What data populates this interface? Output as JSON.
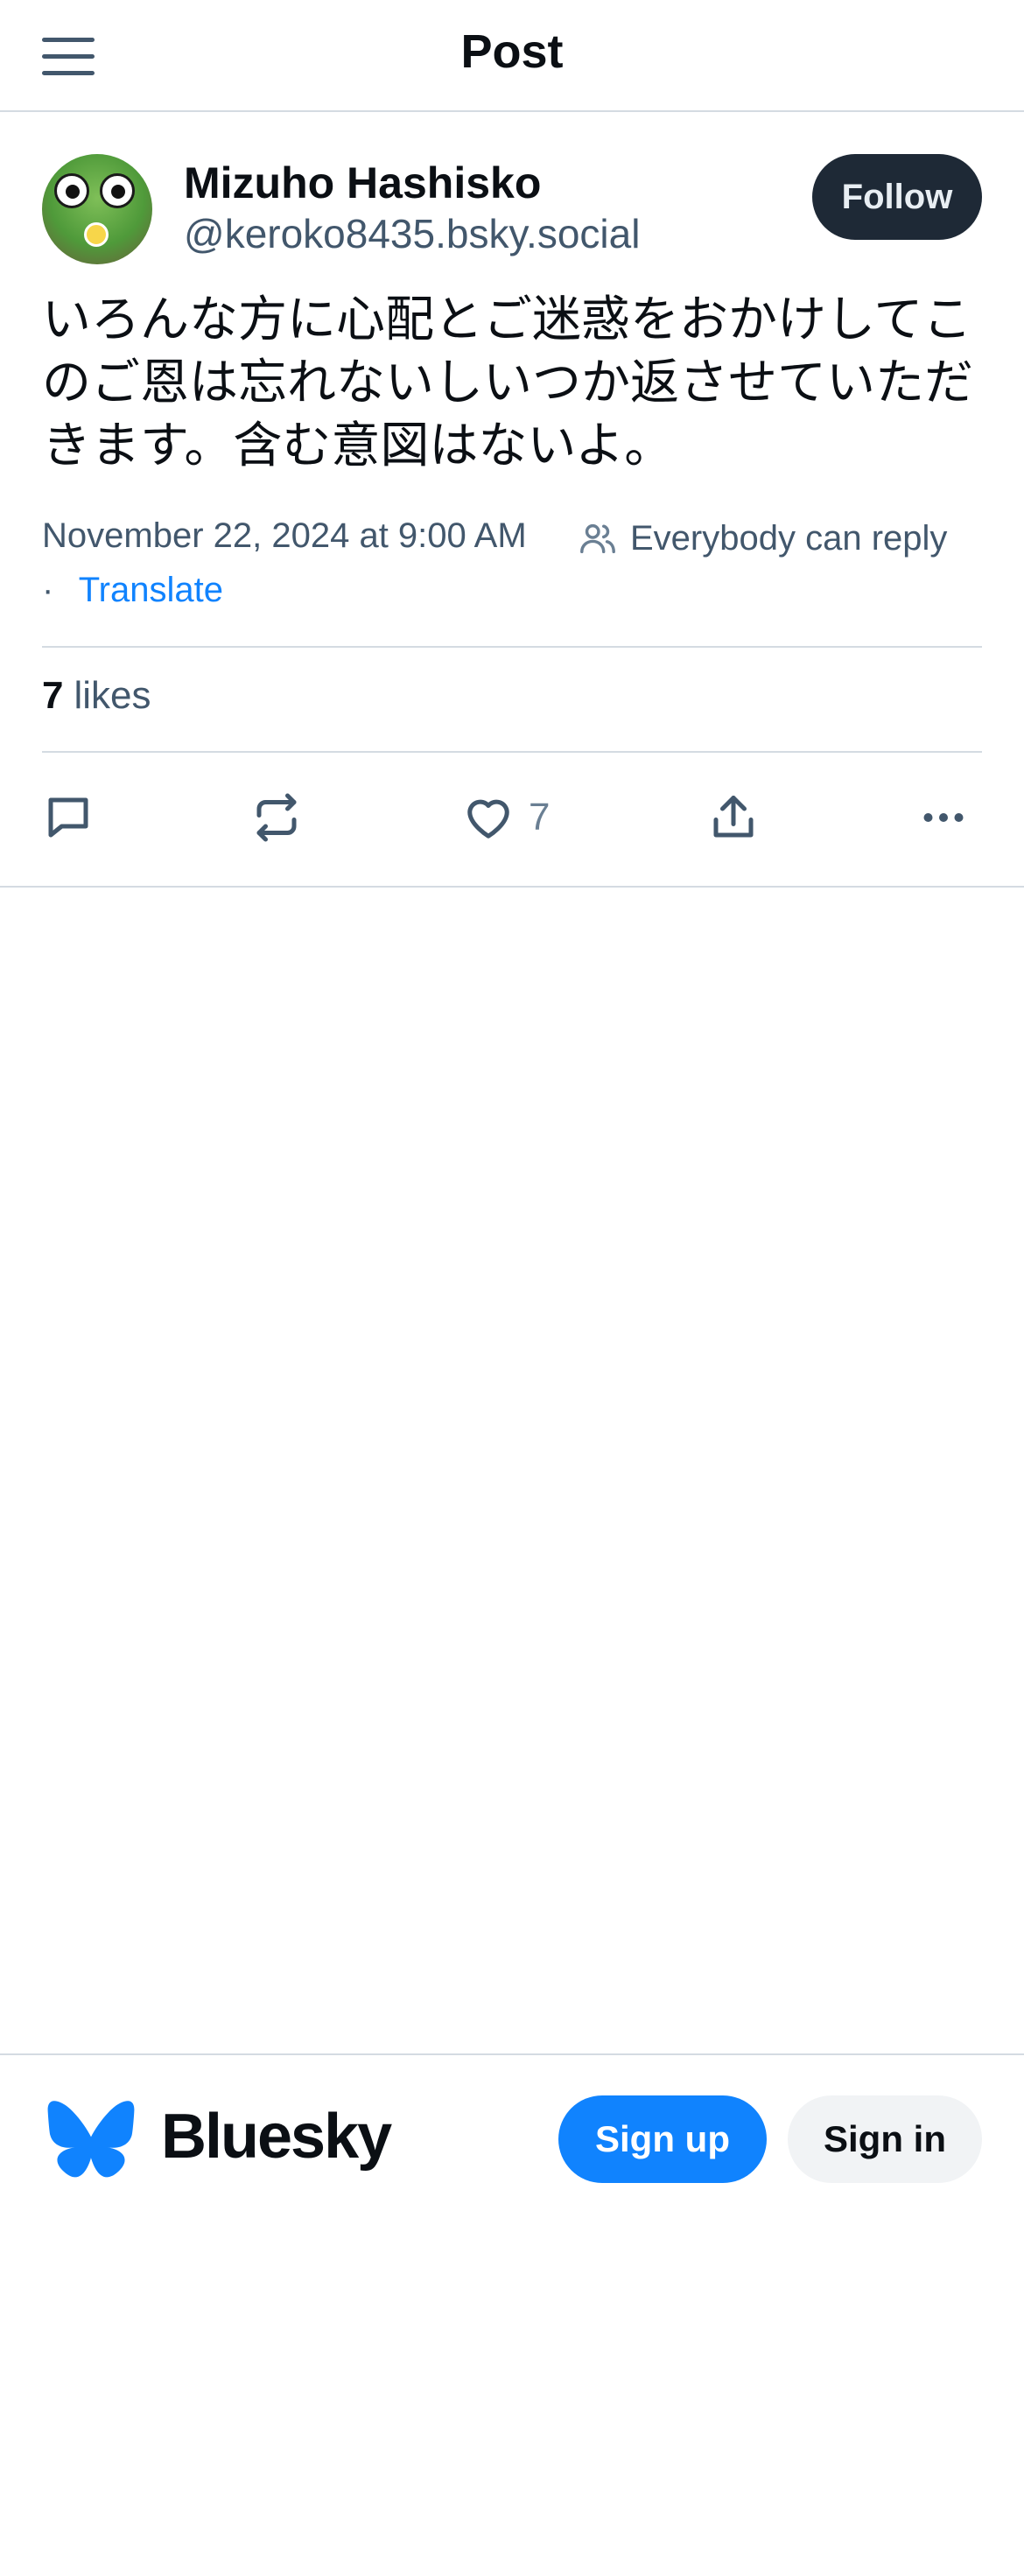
{
  "header": {
    "title": "Post",
    "menu_icon": "hamburger-menu-icon"
  },
  "post": {
    "author": {
      "display_name": "Mizuho Hashisko",
      "handle": "@keroko8435.bsky.social"
    },
    "follow_label": "Follow",
    "text": "いろんな方に心配とご迷惑をおかけしてこのご恩は忘れないしいつか返させていただきます。含む意図はないよ。",
    "timestamp": "November 22, 2024 at 9:00 AM",
    "reply_setting": "Everybody can reply",
    "translate_label": "Translate",
    "separator": "·",
    "likes": {
      "count": "7",
      "label": "likes"
    },
    "actions": {
      "reply_icon": "reply-icon",
      "repost_icon": "repost-icon",
      "like_icon": "heart-icon",
      "like_count": "7",
      "share_icon": "share-icon",
      "more_icon": "more-options-icon"
    }
  },
  "footer": {
    "brand": "Bluesky",
    "signup_label": "Sign up",
    "signin_label": "Sign in"
  },
  "colors": {
    "accent": "#1083fe",
    "follow_bg": "#1e2936",
    "muted_text": "#42576c",
    "divider": "#d4dbe2"
  }
}
